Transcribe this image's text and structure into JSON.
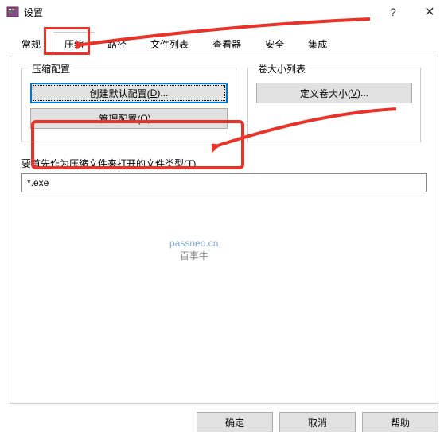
{
  "window": {
    "title": "设置"
  },
  "tabs": {
    "general": "常规",
    "compression": "压缩",
    "path": "路径",
    "filelist": "文件列表",
    "viewer": "查看器",
    "security": "安全",
    "integration": "集成"
  },
  "compressGroup": {
    "title": "压缩配置",
    "createDefault": "创建默认配置(",
    "createDefaultKey": "D",
    "createDefaultSuffix": ")...",
    "manage": "管理配置(",
    "manageKey": "O",
    "manageSuffix": ")..."
  },
  "volumeGroup": {
    "title": "卷大小列表",
    "defineSize": "定义卷大小(",
    "defineSizeKey": "V",
    "defineSizeSuffix": ")..."
  },
  "fileTypeLabel": "要首先作为压缩文件来打开的文件类型(",
  "fileTypeKey": "T",
  "fileTypeSuffix": ")",
  "fileTypeValue": "*.exe",
  "watermark": {
    "line1": "passneo.cn",
    "line2": "百事牛"
  },
  "footer": {
    "ok": "确定",
    "cancel": "取消",
    "help": "帮助"
  }
}
